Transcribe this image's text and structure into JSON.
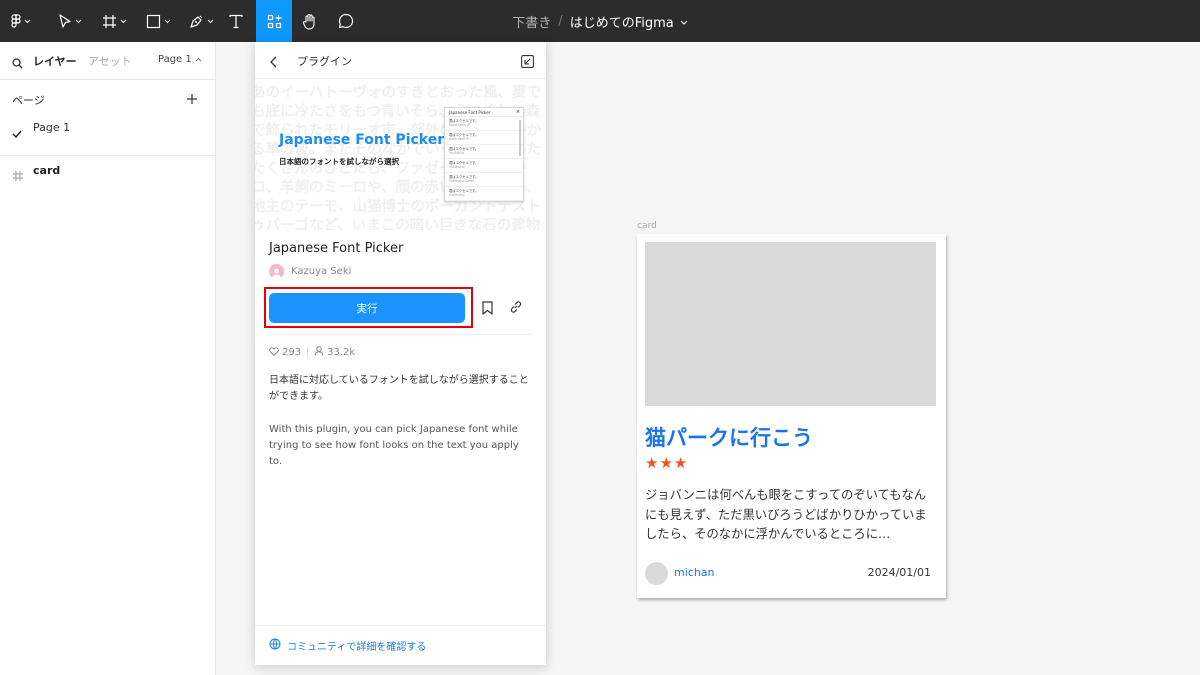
{
  "toolbar": {
    "tools": [
      {
        "icon": "figma-menu-icon"
      },
      {
        "icon": "move-tool-icon"
      },
      {
        "icon": "frame-tool-icon"
      },
      {
        "icon": "shape-tool-icon"
      },
      {
        "icon": "pen-tool-icon"
      },
      {
        "icon": "text-tool-icon"
      },
      {
        "icon": "resources-icon",
        "active": true
      },
      {
        "icon": "hand-tool-icon"
      },
      {
        "icon": "comment-icon"
      }
    ],
    "breadcrumb": {
      "draft": "下書き",
      "separator": "/",
      "file": "はじめてのFigma"
    },
    "active_color": "#0d99ff"
  },
  "left_panel": {
    "tab_layers": "レイヤー",
    "tab_assets": "アセット",
    "page_selector": "Page 1",
    "pages_title": "ページ",
    "pages": [
      "Page 1"
    ],
    "layers": [
      {
        "name": "card",
        "icon": "frame-icon"
      }
    ]
  },
  "plugin": {
    "header_title": "プラグイン",
    "banner": {
      "logo_text": "Japanese Font Picker",
      "subtitle": "日本語のフォントを試しながら選択",
      "background_text": "あのイーハトーヴォのすきとおった風、夏でも底に冷たさをもつ青いそら、うつくしい森で飾られたモリーオ市、郊外のぎらぎらひかる草の波。またそのなかでいっしょになったたくさんのひとたち、ファゼーロとロザーロ、羊飼のミーロや、顔の赤いこどもたち、地主のテーモ、山猫博士のボーガントデストゥパーゴなど、いまこの暗い巨きな石の建物のなかで考えていると、みんなむかし風の",
      "thumb_title": "Japanese Font Picker",
      "thumb_rows": [
        {
          "text": "君はエクセルです。",
          "sub": "Noto Sans JP"
        },
        {
          "text": "君はエクセルです。",
          "sub": "Noto Serif JP"
        },
        {
          "text": "君はエクセルです。",
          "sub": "Yu Gothic"
        },
        {
          "text": "君はエクセルです。",
          "sub": "YuMincho"
        },
        {
          "text": "君はエクセルです。",
          "sub": "YuMincho Demi"
        },
        {
          "text": "君はエクセルです。",
          "sub": "YuMincho"
        }
      ]
    },
    "name": "Japanese Font Picker",
    "author": "Kazuya Seki",
    "run_label": "実行",
    "likes": "293",
    "users": "33.2k",
    "description_ja": "日本語に対応しているフォントを試しながら選択することができます。",
    "description_en": "With this plugin, you can pick Japanese font while trying to see how font looks on the text you apply to.",
    "footer_link": "コミュニティで詳細を確認する"
  },
  "canvas": {
    "frame_label": "card",
    "card": {
      "title": "猫パークに行こう",
      "stars": "★★★",
      "body": "ジョバンニは何べんも眼をこすってのぞいてもなんにも見えず、ただ黒いびろうどばかりひかっていましたら、そのなかに浮かんでいるところに…",
      "author": "michan",
      "date": "2024/01/01",
      "title_color": "#1a73e8",
      "star_color": "#f4511e"
    }
  }
}
